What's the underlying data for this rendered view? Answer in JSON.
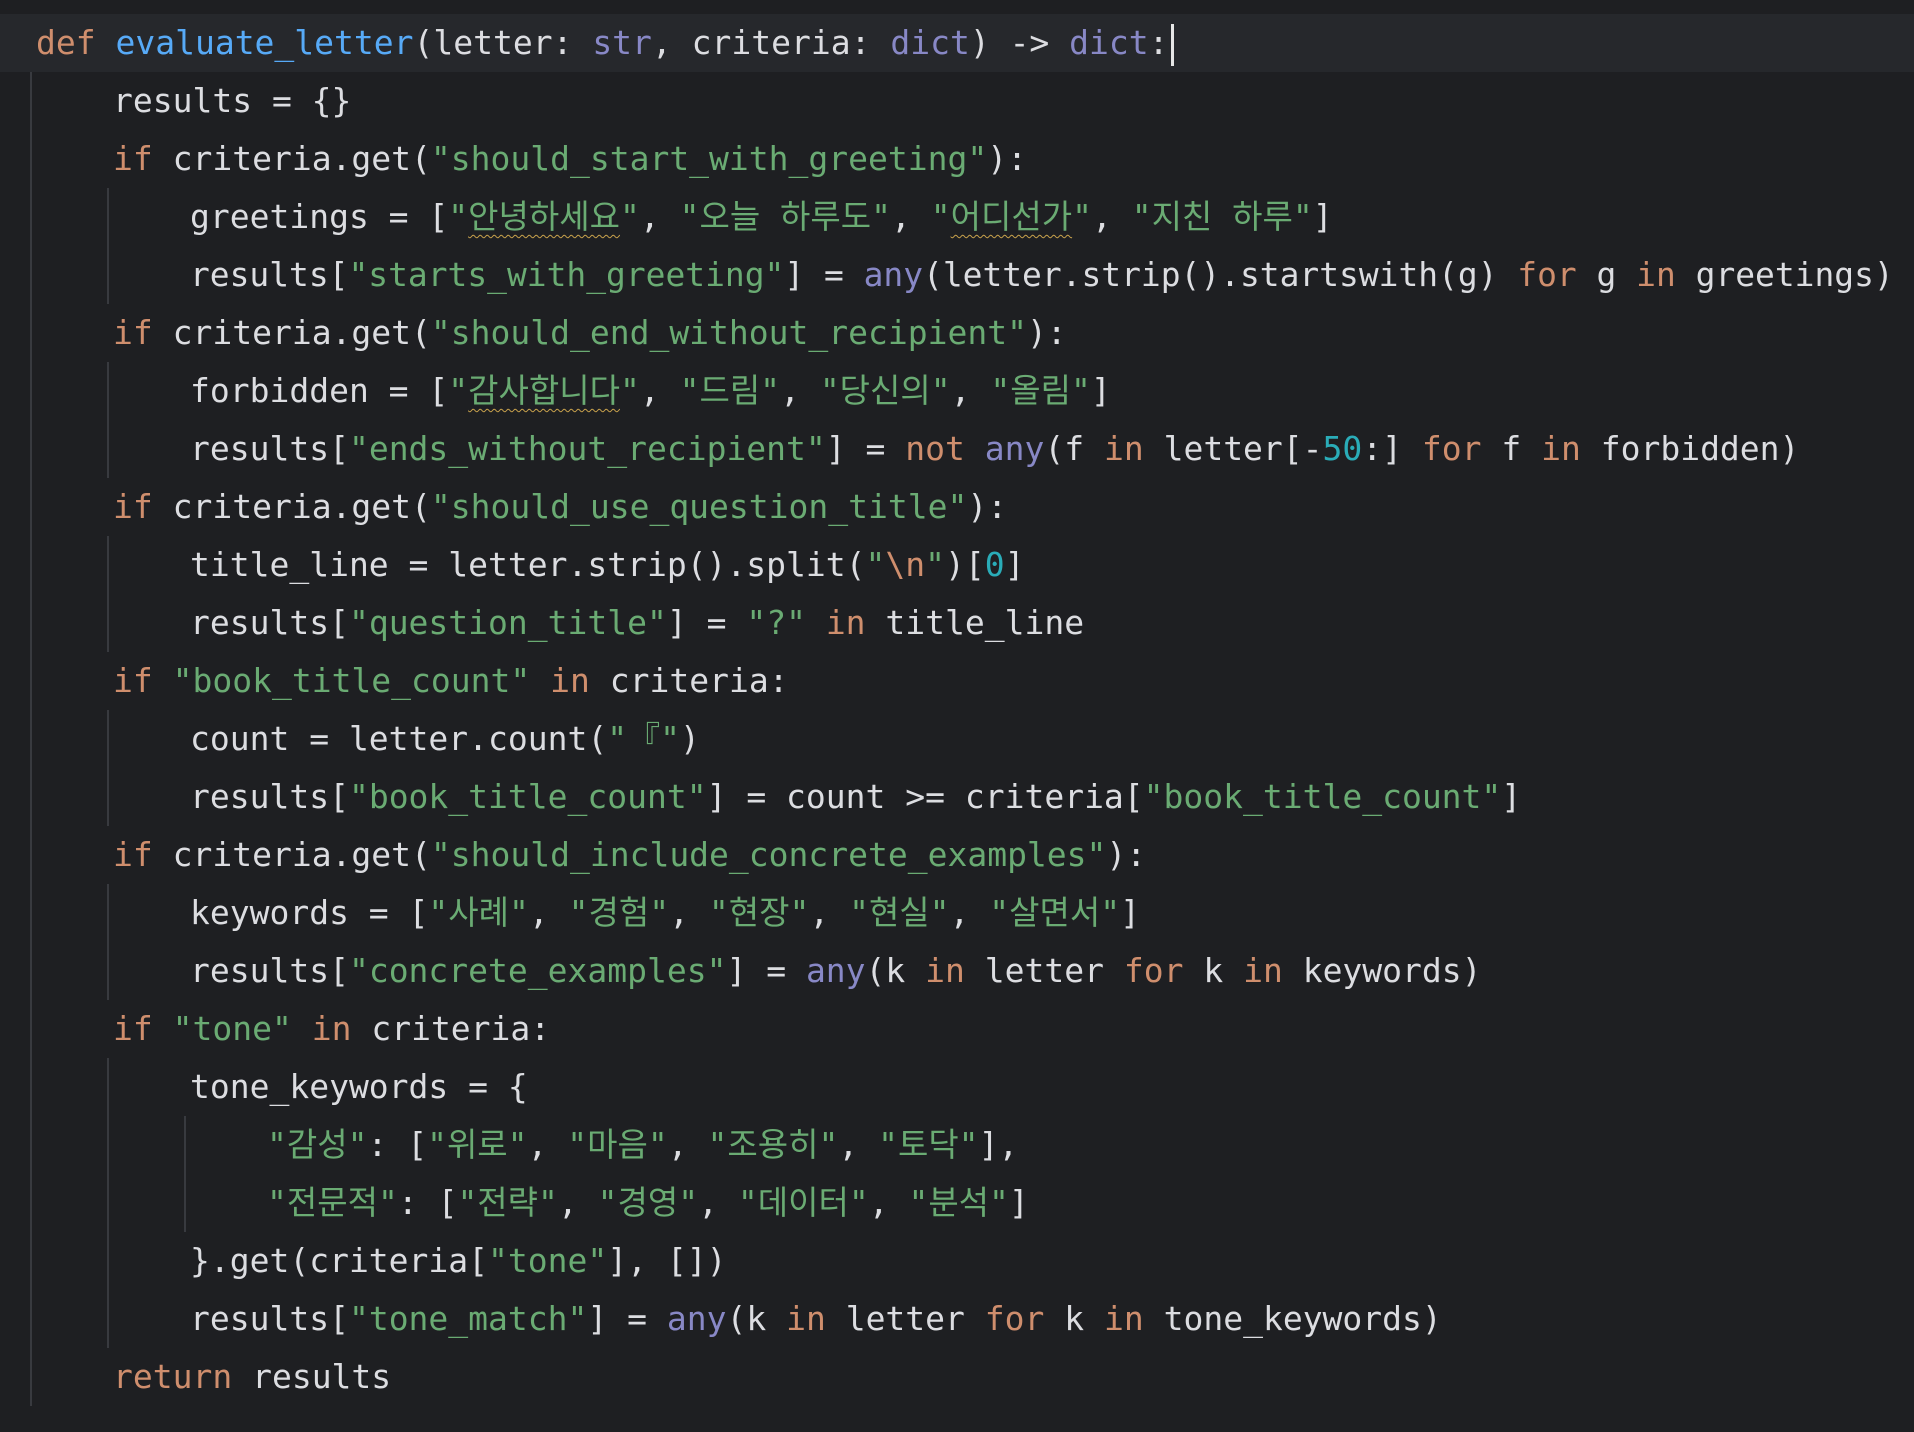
{
  "editor": {
    "language": "python",
    "caret_line": 1,
    "lines": [
      {
        "indent": 0,
        "tokens": [
          [
            "def",
            "kw"
          ],
          [
            " ",
            ""
          ],
          [
            "evaluate_letter",
            "fn"
          ],
          [
            "(letter: ",
            ""
          ],
          [
            "str",
            "bi"
          ],
          [
            ", criteria: ",
            ""
          ],
          [
            "dict",
            "bi"
          ],
          [
            ") -> ",
            ""
          ],
          [
            "dict",
            "bi"
          ],
          [
            ":",
            ""
          ]
        ]
      },
      {
        "indent": 1,
        "tokens": [
          [
            "results = {}",
            ""
          ]
        ]
      },
      {
        "indent": 1,
        "tokens": [
          [
            "if",
            "kw"
          ],
          [
            " criteria.get(",
            ""
          ],
          [
            "\"should_start_with_greeting\"",
            "str"
          ],
          [
            "):",
            ""
          ]
        ]
      },
      {
        "indent": 2,
        "tokens": [
          [
            "greetings = [",
            ""
          ],
          [
            "\"",
            "str"
          ],
          [
            "안녕하세요",
            "str sq"
          ],
          [
            "\"",
            "str"
          ],
          [
            ", ",
            ""
          ],
          [
            "\"오늘 하루도\"",
            "str"
          ],
          [
            ", ",
            ""
          ],
          [
            "\"",
            "str"
          ],
          [
            "어디선가",
            "str sq"
          ],
          [
            "\"",
            "str"
          ],
          [
            ", ",
            ""
          ],
          [
            "\"지친 하루\"",
            "str"
          ],
          [
            "]",
            ""
          ]
        ]
      },
      {
        "indent": 2,
        "tokens": [
          [
            "results[",
            ""
          ],
          [
            "\"starts_with_greeting\"",
            "str"
          ],
          [
            "] = ",
            ""
          ],
          [
            "any",
            "bi"
          ],
          [
            "(letter.strip().startswith(g) ",
            ""
          ],
          [
            "for",
            "kw"
          ],
          [
            " g ",
            ""
          ],
          [
            "in",
            "kw"
          ],
          [
            " greetings)",
            ""
          ]
        ]
      },
      {
        "indent": 1,
        "tokens": [
          [
            "if",
            "kw"
          ],
          [
            " criteria.get(",
            ""
          ],
          [
            "\"should_end_without_recipient\"",
            "str"
          ],
          [
            "):",
            ""
          ]
        ]
      },
      {
        "indent": 2,
        "tokens": [
          [
            "forbidden = [",
            ""
          ],
          [
            "\"",
            "str"
          ],
          [
            "감사합니다",
            "str sq"
          ],
          [
            "\"",
            "str"
          ],
          [
            ", ",
            ""
          ],
          [
            "\"드림\"",
            "str"
          ],
          [
            ", ",
            ""
          ],
          [
            "\"당신의\"",
            "str"
          ],
          [
            ", ",
            ""
          ],
          [
            "\"올림\"",
            "str"
          ],
          [
            "]",
            ""
          ]
        ]
      },
      {
        "indent": 2,
        "tokens": [
          [
            "results[",
            ""
          ],
          [
            "\"ends_without_recipient\"",
            "str"
          ],
          [
            "] = ",
            ""
          ],
          [
            "not",
            "kw"
          ],
          [
            " ",
            ""
          ],
          [
            "any",
            "bi"
          ],
          [
            "(f ",
            ""
          ],
          [
            "in",
            "kw"
          ],
          [
            " letter[-",
            ""
          ],
          [
            "50",
            "num"
          ],
          [
            ":] ",
            ""
          ],
          [
            "for",
            "kw"
          ],
          [
            " f ",
            ""
          ],
          [
            "in",
            "kw"
          ],
          [
            " forbidden)",
            ""
          ]
        ]
      },
      {
        "indent": 1,
        "tokens": [
          [
            "if",
            "kw"
          ],
          [
            " criteria.get(",
            ""
          ],
          [
            "\"should_use_question_title\"",
            "str"
          ],
          [
            "):",
            ""
          ]
        ]
      },
      {
        "indent": 2,
        "tokens": [
          [
            "title_line = letter.strip().split(",
            ""
          ],
          [
            "\"",
            "str"
          ],
          [
            "\\n",
            "esc"
          ],
          [
            "\"",
            "str"
          ],
          [
            ")[",
            ""
          ],
          [
            "0",
            "num"
          ],
          [
            "]",
            ""
          ]
        ]
      },
      {
        "indent": 2,
        "tokens": [
          [
            "results[",
            ""
          ],
          [
            "\"question_title\"",
            "str"
          ],
          [
            "] = ",
            ""
          ],
          [
            "\"?\"",
            "str"
          ],
          [
            " ",
            ""
          ],
          [
            "in",
            "kw"
          ],
          [
            " title_line",
            ""
          ]
        ]
      },
      {
        "indent": 1,
        "tokens": [
          [
            "if",
            "kw"
          ],
          [
            " ",
            ""
          ],
          [
            "\"book_title_count\"",
            "str"
          ],
          [
            " ",
            ""
          ],
          [
            "in",
            "kw"
          ],
          [
            " criteria:",
            ""
          ]
        ]
      },
      {
        "indent": 2,
        "tokens": [
          [
            "count = letter.count(",
            ""
          ],
          [
            "\"『\"",
            "str"
          ],
          [
            ")",
            ""
          ]
        ]
      },
      {
        "indent": 2,
        "tokens": [
          [
            "results[",
            ""
          ],
          [
            "\"book_title_count\"",
            "str"
          ],
          [
            "] = count >= criteria[",
            ""
          ],
          [
            "\"book_title_count\"",
            "str"
          ],
          [
            "]",
            ""
          ]
        ]
      },
      {
        "indent": 1,
        "tokens": [
          [
            "if",
            "kw"
          ],
          [
            " criteria.get(",
            ""
          ],
          [
            "\"should_include_concrete_examples\"",
            "str"
          ],
          [
            "):",
            ""
          ]
        ]
      },
      {
        "indent": 2,
        "tokens": [
          [
            "keywords = [",
            ""
          ],
          [
            "\"사례\"",
            "str"
          ],
          [
            ", ",
            ""
          ],
          [
            "\"경험\"",
            "str"
          ],
          [
            ", ",
            ""
          ],
          [
            "\"현장\"",
            "str"
          ],
          [
            ", ",
            ""
          ],
          [
            "\"현실\"",
            "str"
          ],
          [
            ", ",
            ""
          ],
          [
            "\"살면서\"",
            "str"
          ],
          [
            "]",
            ""
          ]
        ]
      },
      {
        "indent": 2,
        "tokens": [
          [
            "results[",
            ""
          ],
          [
            "\"concrete_examples\"",
            "str"
          ],
          [
            "] = ",
            ""
          ],
          [
            "any",
            "bi"
          ],
          [
            "(k ",
            ""
          ],
          [
            "in",
            "kw"
          ],
          [
            " letter ",
            ""
          ],
          [
            "for",
            "kw"
          ],
          [
            " k ",
            ""
          ],
          [
            "in",
            "kw"
          ],
          [
            " keywords)",
            ""
          ]
        ]
      },
      {
        "indent": 1,
        "tokens": [
          [
            "if",
            "kw"
          ],
          [
            " ",
            ""
          ],
          [
            "\"tone\"",
            "str"
          ],
          [
            " ",
            ""
          ],
          [
            "in",
            "kw"
          ],
          [
            " criteria:",
            ""
          ]
        ]
      },
      {
        "indent": 2,
        "tokens": [
          [
            "tone_keywords = {",
            ""
          ]
        ]
      },
      {
        "indent": 3,
        "tokens": [
          [
            "\"감성\"",
            "str"
          ],
          [
            ": [",
            ""
          ],
          [
            "\"위로\"",
            "str"
          ],
          [
            ", ",
            ""
          ],
          [
            "\"마음\"",
            "str"
          ],
          [
            ", ",
            ""
          ],
          [
            "\"조용히\"",
            "str"
          ],
          [
            ", ",
            ""
          ],
          [
            "\"토닥\"",
            "str"
          ],
          [
            "],",
            ""
          ]
        ]
      },
      {
        "indent": 3,
        "tokens": [
          [
            "\"전문적\"",
            "str"
          ],
          [
            ": [",
            ""
          ],
          [
            "\"전략\"",
            "str"
          ],
          [
            ", ",
            ""
          ],
          [
            "\"경영\"",
            "str"
          ],
          [
            ", ",
            ""
          ],
          [
            "\"데이터\"",
            "str"
          ],
          [
            ", ",
            ""
          ],
          [
            "\"분석\"",
            "str"
          ],
          [
            "]",
            ""
          ]
        ]
      },
      {
        "indent": 2,
        "tokens": [
          [
            "}.get(criteria[",
            ""
          ],
          [
            "\"tone\"",
            "str"
          ],
          [
            "], [])",
            ""
          ]
        ]
      },
      {
        "indent": 2,
        "tokens": [
          [
            "results[",
            ""
          ],
          [
            "\"tone_match\"",
            "str"
          ],
          [
            "] = ",
            ""
          ],
          [
            "any",
            "bi"
          ],
          [
            "(k ",
            ""
          ],
          [
            "in",
            "kw"
          ],
          [
            " letter ",
            ""
          ],
          [
            "for",
            "kw"
          ],
          [
            " k ",
            ""
          ],
          [
            "in",
            "kw"
          ],
          [
            " tone_keywords)",
            ""
          ]
        ]
      },
      {
        "indent": 1,
        "tokens": [
          [
            "return",
            "kw"
          ],
          [
            " results",
            ""
          ]
        ]
      }
    ]
  }
}
